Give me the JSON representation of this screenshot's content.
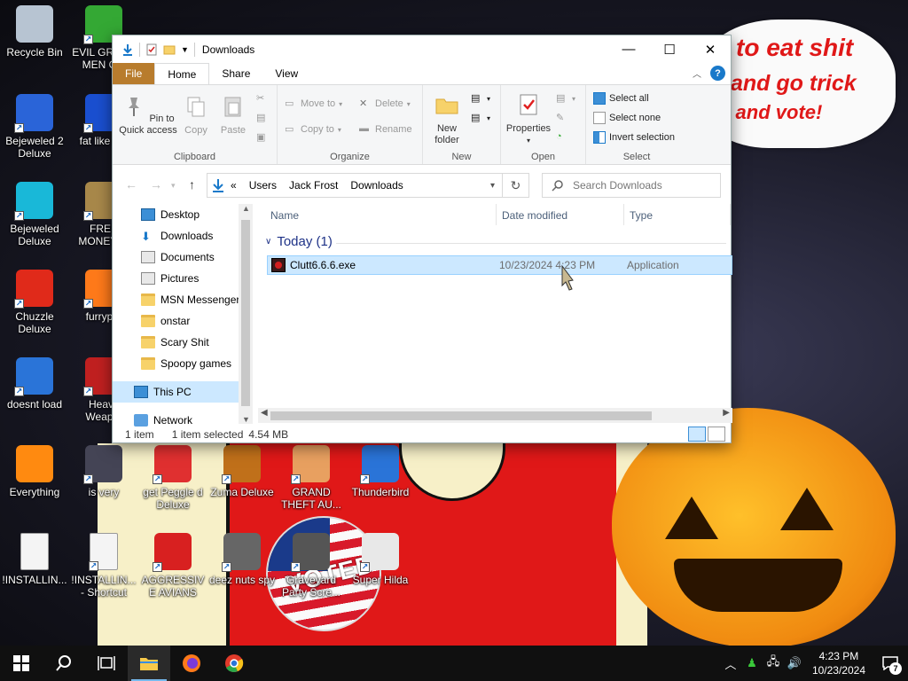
{
  "wallpaper": {
    "speech_lines": [
      "to eat shit",
      "and go trick",
      "g and vote!"
    ],
    "voted_text": "VOTED"
  },
  "desktop_icons": [
    {
      "label": "Recycle Bin",
      "icon": "recycle-bin-icon",
      "color": "#b7c4d2"
    },
    {
      "label": "EVIL GREEN MEN C...",
      "icon": "evil-green-men-icon",
      "color": "#34a834"
    },
    {
      "label": "Bejeweled 2 Deluxe",
      "icon": "bejeweled2-icon",
      "color": "#2a64d8"
    },
    {
      "label": "fat like d...",
      "icon": "mahjong-icon",
      "color": "#1a4fd0"
    },
    {
      "label": "Bejeweled Deluxe",
      "icon": "bejeweled-icon",
      "color": "#19b8d8"
    },
    {
      "label": "FREE MONEY!...",
      "icon": "money-bag-icon",
      "color": "#a8884a"
    },
    {
      "label": "Chuzzle Deluxe",
      "icon": "chuzzle-icon",
      "color": "#e02a1a"
    },
    {
      "label": "furryp...",
      "icon": "firefox-icon",
      "color": "#ff7a1a"
    },
    {
      "label": "doesnt load",
      "icon": "thunderbird-icon",
      "color": "#2a74d8"
    },
    {
      "label": "Heavy Weap...",
      "icon": "heavy-weapon-icon",
      "color": "#c02020"
    },
    {
      "label": "Everything",
      "icon": "everything-search-icon",
      "color": "#ff8a10"
    },
    {
      "label": "is very",
      "icon": "shield-icon",
      "color": "#445"
    },
    {
      "label": "get Peggle d Deluxe",
      "icon": "peggle-icon",
      "color": "#e03030"
    },
    {
      "label": "Zuma Deluxe",
      "icon": "zuma-icon",
      "color": "#c0701a"
    },
    {
      "label": "GRAND THEFT AU...",
      "icon": "anime-girl-icon",
      "color": "#e8a060"
    },
    {
      "label": "Thunderbird",
      "icon": "thunderbird-icon",
      "color": "#2a74d8"
    },
    {
      "label": "!INSTALLIN...",
      "icon": "text-file-icon",
      "color": "#f4f4f4"
    },
    {
      "label": "!INSTALLIN... - Shortcut",
      "icon": "text-file-icon",
      "color": "#f4f4f4"
    },
    {
      "label": "AGGRESSIVE AVIANS",
      "icon": "angry-bird-icon",
      "color": "#d82020"
    },
    {
      "label": "deez nuts spy",
      "icon": "windows-stack-icon",
      "color": "#666"
    },
    {
      "label": "Graveyard Party Scre...",
      "icon": "graveyard-icon",
      "color": "#555"
    },
    {
      "label": "Super Hilda",
      "icon": "pixel-dog-icon",
      "color": "#e8e8e8"
    }
  ],
  "explorer": {
    "title": "Downloads",
    "tabs": {
      "file": "File",
      "home": "Home",
      "share": "Share",
      "view": "View"
    },
    "ribbon": {
      "pin": "Pin to Quick access",
      "copy": "Copy",
      "paste": "Paste",
      "clipboard_group": "Clipboard",
      "move_to": "Move to",
      "delete": "Delete",
      "copy_to": "Copy to",
      "rename": "Rename",
      "organize_group": "Organize",
      "new_folder": "New folder",
      "new_group": "New",
      "properties": "Properties",
      "open_group": "Open",
      "select_all": "Select all",
      "select_none": "Select none",
      "invert_selection": "Invert selection",
      "select_group": "Select"
    },
    "address": {
      "crumbs": [
        "Users",
        "Jack Frost",
        "Downloads"
      ],
      "overflow": "«",
      "search_placeholder": "Search Downloads"
    },
    "nav": [
      {
        "label": "Desktop",
        "pinned": true,
        "icon": "desktop-icon"
      },
      {
        "label": "Downloads",
        "pinned": true,
        "icon": "download-arrow-icon"
      },
      {
        "label": "Documents",
        "pinned": true,
        "icon": "documents-icon"
      },
      {
        "label": "Pictures",
        "pinned": true,
        "icon": "pictures-icon"
      },
      {
        "label": "MSN Messenger",
        "pinned": false,
        "icon": "folder-icon"
      },
      {
        "label": "onstar",
        "pinned": false,
        "icon": "folder-icon"
      },
      {
        "label": "Scary Shit",
        "pinned": false,
        "icon": "folder-icon"
      },
      {
        "label": "Spoopy games",
        "pinned": false,
        "icon": "folder-icon"
      },
      {
        "label": "This PC",
        "pinned": false,
        "icon": "computer-icon"
      },
      {
        "label": "Network",
        "pinned": false,
        "icon": "network-icon"
      }
    ],
    "columns": {
      "name": "Name",
      "date": "Date modified",
      "type": "Type"
    },
    "group_label": "Today (1)",
    "files": [
      {
        "name": "Clutt6.6.6.exe",
        "date": "10/23/2024 4:23 PM",
        "type": "Application"
      }
    ],
    "status": {
      "count": "1 item",
      "selected": "1 item selected",
      "size": "4.54 MB"
    }
  },
  "taskbar": {
    "time": "4:23 PM",
    "date": "10/23/2024",
    "notification_count": "7"
  },
  "colors": {
    "ribbon_file_tab": "#b87c2d",
    "selection": "#cce8ff",
    "accent": "#1979ca",
    "taskbar": "#101010"
  }
}
